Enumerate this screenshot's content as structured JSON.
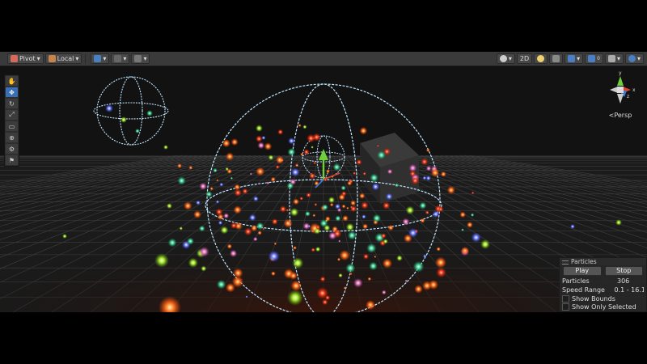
{
  "toolbar": {
    "pivot_label": "Pivot",
    "local_label": "Local",
    "mode_2d_label": "2D"
  },
  "tools": [
    "hand",
    "move",
    "rotate",
    "scale",
    "rect",
    "transform",
    "custom",
    "editor"
  ],
  "gizmo": {
    "projection_label": "Persp",
    "axes": {
      "x": "x",
      "y": "y",
      "z": "z"
    }
  },
  "particles_overlay": {
    "title": "Particles",
    "play_label": "Play",
    "stop_label": "Stop",
    "rows": [
      {
        "label": "Particles",
        "value": "306"
      },
      {
        "label": "Speed Range",
        "value": "0.1 - 16.1"
      }
    ],
    "checkboxes": [
      "Show Bounds",
      "Show Only Selected"
    ]
  },
  "colors": {
    "toolbar_bg": "#3a3a3a",
    "accent_blue": "#3b6fb5",
    "gizmo_x": "#e0422f",
    "gizmo_y": "#6fcf3b",
    "gizmo_z": "#3d7bd9",
    "bounds_wire": "#bfe6ff"
  }
}
